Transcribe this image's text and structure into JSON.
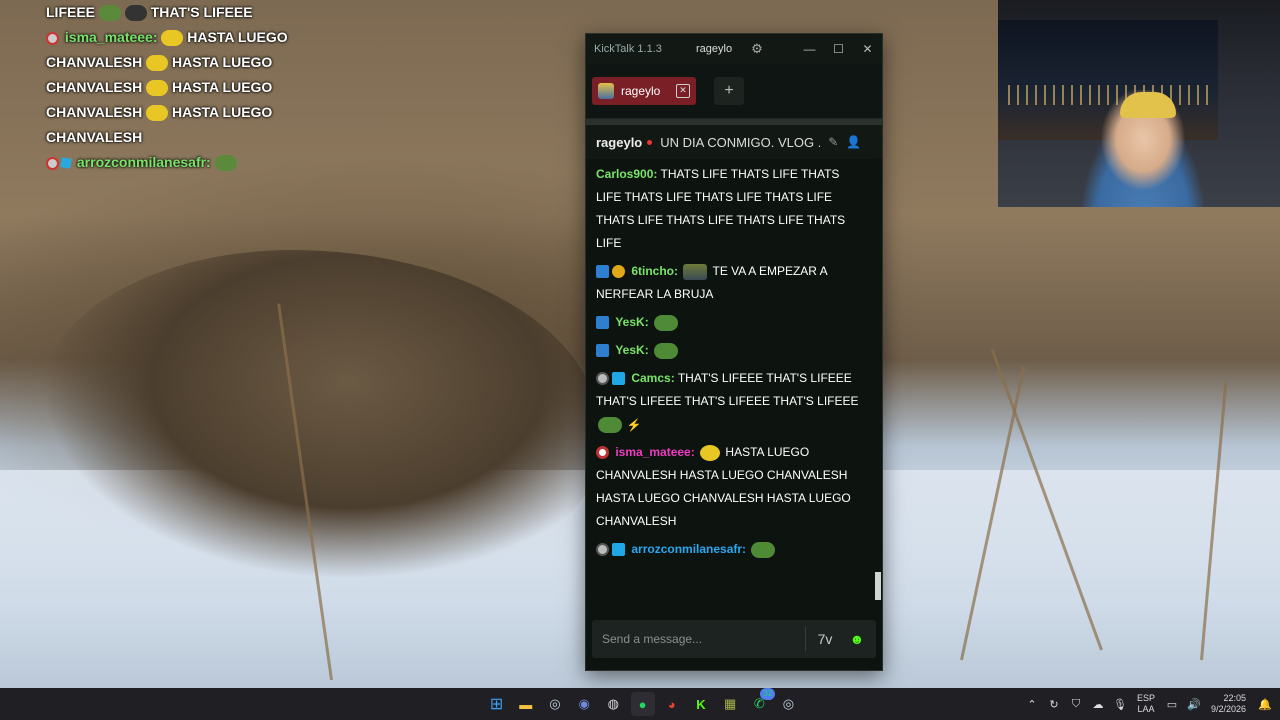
{
  "overlay_chat": {
    "line0": "LIFEEE",
    "line0b": "THAT'S LIFEEE",
    "user1": "isma_mateee:",
    "text1": "HASTA LUEGO",
    "rows": [
      {
        "a": "CHANVALESH",
        "b": "HASTA LUEGO"
      },
      {
        "a": "CHANVALESH",
        "b": "HASTA LUEGO"
      },
      {
        "a": "CHANVALESH",
        "b": "HASTA LUEGO"
      }
    ],
    "last": "CHANVALESH",
    "user2": "arrozconmilanesafr:"
  },
  "kicktalk": {
    "app_title": "KickTalk 1.1.3",
    "current_user": "rageylo",
    "tab": {
      "label": "rageylo"
    },
    "add_tab": "+",
    "channel": {
      "name": "rageylo",
      "stream_title": "UN DIA CONMIGO. VLOG ..."
    },
    "messages": [
      {
        "user": "Carlos900:",
        "color": "#7ae36a",
        "text": "THATS LIFE  THATS LIFE THATS LIFE THATS LIFE THATS LIFE THATS LIFE THATS LIFE THATS LIFE THATS LIFE THATS LIFE"
      },
      {
        "user": "6tincho:",
        "color": "#7ae36a",
        "text": "TE VA A EMPEZAR A NERFEAR LA BRUJA"
      },
      {
        "user": "YesK:",
        "color": "#7ae36a",
        "text": ""
      },
      {
        "user": "YesK:",
        "color": "#7ae36a",
        "text": ""
      },
      {
        "user": "Camcs:",
        "color": "#7ae36a",
        "text": "THAT'S LIFEEE  THAT'S LIFEEE  THAT'S LIFEEE  THAT'S LIFEEE  THAT'S LIFEEE"
      },
      {
        "user": "isma_mateee:",
        "color": "#f03cc0",
        "text": "HASTA LUEGO CHANVALESH HASTA LUEGO CHANVALESH HASTA LUEGO CHANVALESH HASTA LUEGO CHANVALESH"
      },
      {
        "user": "arrozconmilanesafr:",
        "color": "#2aa7f0",
        "text": ""
      }
    ],
    "input_placeholder": "Send a message..."
  },
  "taskbar": {
    "icons": [
      "windows-start",
      "file-explorer",
      "steam",
      "discord",
      "obs",
      "spotify",
      "chrome",
      "kick",
      "emote-app",
      "whatsapp",
      "steam-2"
    ],
    "whatsapp_badge": "32",
    "lang_top": "ESP",
    "lang_bottom": "LAA",
    "time": "22:05",
    "date": "9/2/2026"
  },
  "colors": {
    "kick_green": "#53fc18",
    "tab_red": "#7a1f25"
  }
}
